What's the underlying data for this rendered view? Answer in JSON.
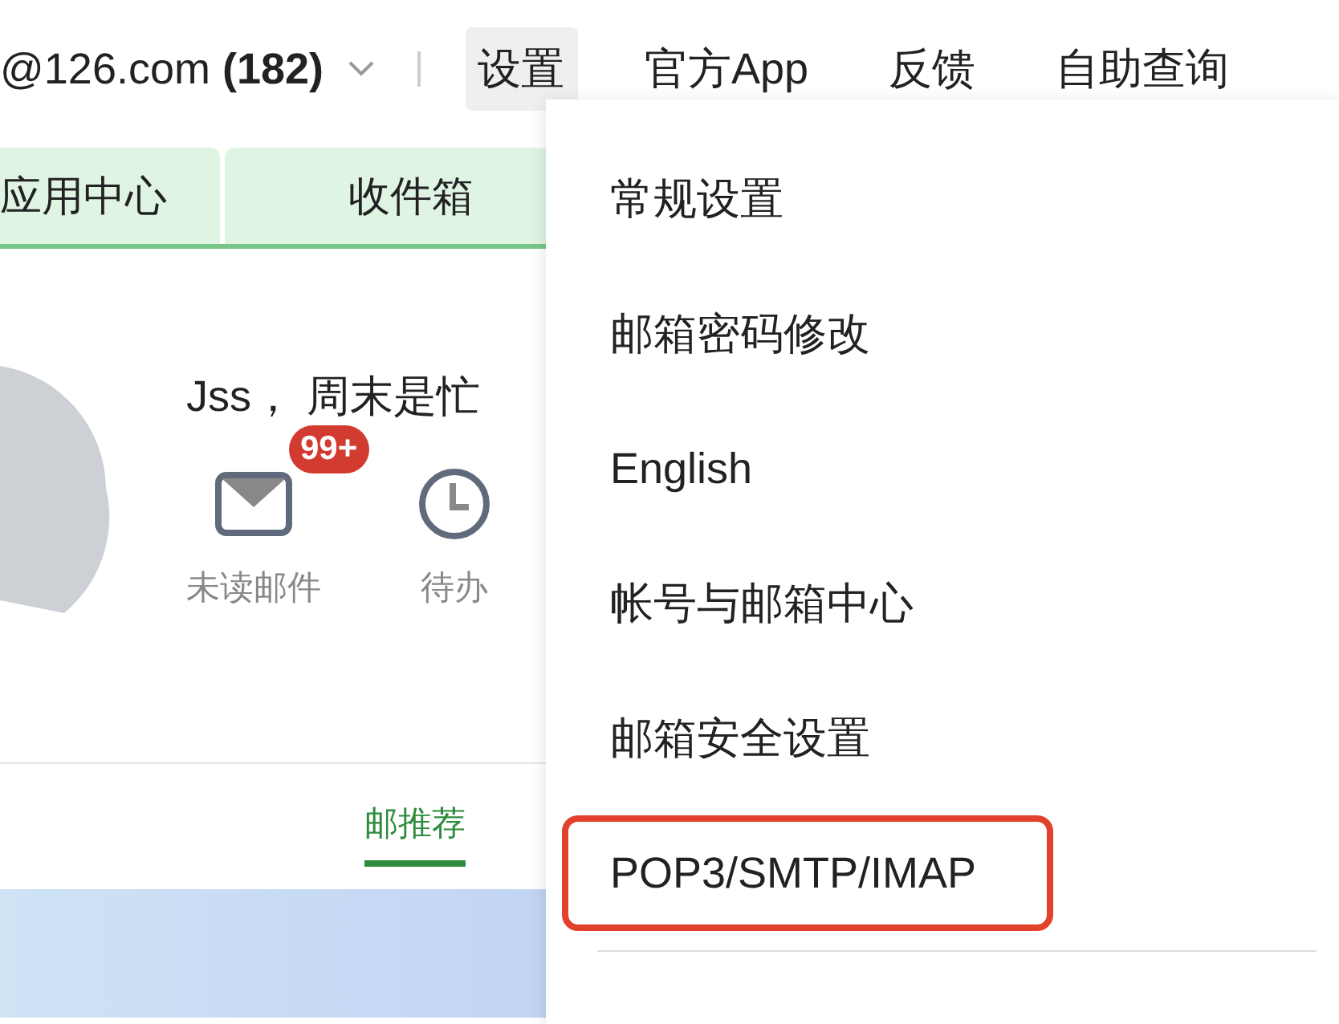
{
  "account": {
    "address": "@126.com **(182)**"
  },
  "nav": [
    {
      "label": "设置",
      "selected": true
    },
    {
      "label": "官方App",
      "selected": false
    },
    {
      "label": "反馈",
      "selected": false
    },
    {
      "label": "自助查询",
      "selected": false
    }
  ],
  "tabs": [
    {
      "label": "应用中心"
    },
    {
      "label": "收件箱"
    }
  ],
  "greeting": "Jss， 周末是忙",
  "shortcuts": [
    {
      "kind": "mail",
      "label": "未读邮件",
      "badge": "99+"
    },
    {
      "kind": "clock",
      "label": "待办"
    }
  ],
  "feed_tabs": [
    {
      "label": "邮推荐",
      "selected": true
    }
  ],
  "settings_menu": [
    {
      "label": "常规设置",
      "highlighted": false
    },
    {
      "label": "邮箱密码修改",
      "highlighted": false
    },
    {
      "label": "English",
      "highlighted": false
    },
    {
      "label": "帐号与邮箱中心",
      "highlighted": false
    },
    {
      "label": "邮箱安全设置",
      "highlighted": false
    },
    {
      "label": "POP3/SMTP/IMAP",
      "highlighted": true
    }
  ]
}
